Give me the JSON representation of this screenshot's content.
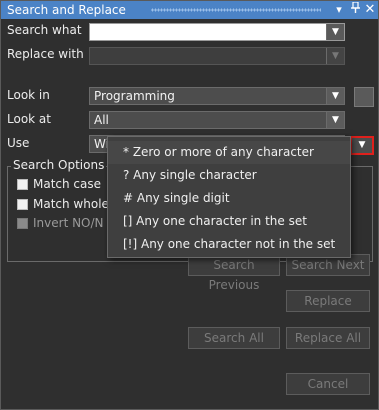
{
  "window": {
    "title": "Search and Replace",
    "dropdown_arrow": "▼",
    "pin_icon": "pin-icon",
    "close_icon": "close-icon"
  },
  "form": {
    "search_what_label": "Search what",
    "search_what_value": "",
    "replace_with_label": "Replace with",
    "replace_with_value": "",
    "look_in_label": "Look in",
    "look_in_value": "Programming",
    "look_at_label": "Look at",
    "look_at_value": "All",
    "use_label": "Use",
    "use_value": "Wi"
  },
  "search_options": {
    "title": "Search Options",
    "match_case": "Match case",
    "match_whole": "Match whole",
    "invert": "Invert NO/N"
  },
  "buttons": {
    "search_previous": "Search Previous",
    "search_next": "Search Next",
    "replace": "Replace",
    "search_all": "Search All",
    "replace_all": "Replace All",
    "cancel": "Cancel"
  },
  "wildcard_menu": [
    "* Zero or more of any character",
    "? Any single character",
    "# Any single digit",
    "[] Any one character in the set",
    "[!] Any one character not in the set"
  ],
  "colors": {
    "titlebar": "#4b83c6",
    "highlight_border": "#e0201c"
  }
}
